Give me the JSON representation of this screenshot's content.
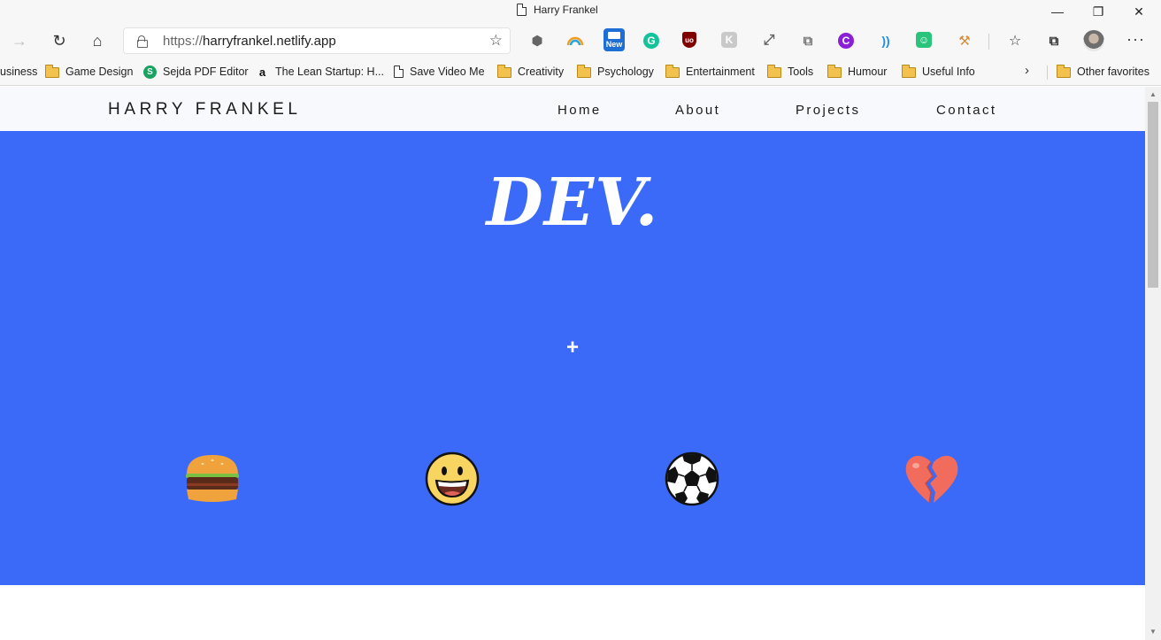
{
  "browser": {
    "window_title": "Harry Frankel",
    "url_protocol": "https://",
    "url_host": "harryfrankel.netlify.app",
    "new_badge": "New"
  },
  "favorites": {
    "items": [
      {
        "label": "usiness",
        "icon": "folder-icon"
      },
      {
        "label": "Game Design",
        "icon": "folder-icon"
      },
      {
        "label": "Sejda PDF Editor",
        "icon": "sejda-icon"
      },
      {
        "label": "The Lean Startup: H...",
        "icon": "amazon-icon"
      },
      {
        "label": "Save Video Me",
        "icon": "page-icon"
      },
      {
        "label": "Creativity",
        "icon": "folder-icon"
      },
      {
        "label": "Psychology",
        "icon": "folder-icon"
      },
      {
        "label": "Entertainment",
        "icon": "folder-icon"
      },
      {
        "label": "Tools",
        "icon": "folder-icon"
      },
      {
        "label": "Humour",
        "icon": "folder-icon"
      },
      {
        "label": "Useful Info",
        "icon": "folder-icon"
      }
    ],
    "other": "Other favorites"
  },
  "site": {
    "brand": "HARRY FRANKEL",
    "nav": [
      "Home",
      "About",
      "Projects",
      "Contact"
    ],
    "hero_title": "DEV.",
    "hero_plus": "+",
    "hero_color": "#3b6af8",
    "emojis": [
      "hamburger-icon",
      "grinning-face-icon",
      "soccer-ball-icon",
      "broken-heart-icon"
    ]
  }
}
